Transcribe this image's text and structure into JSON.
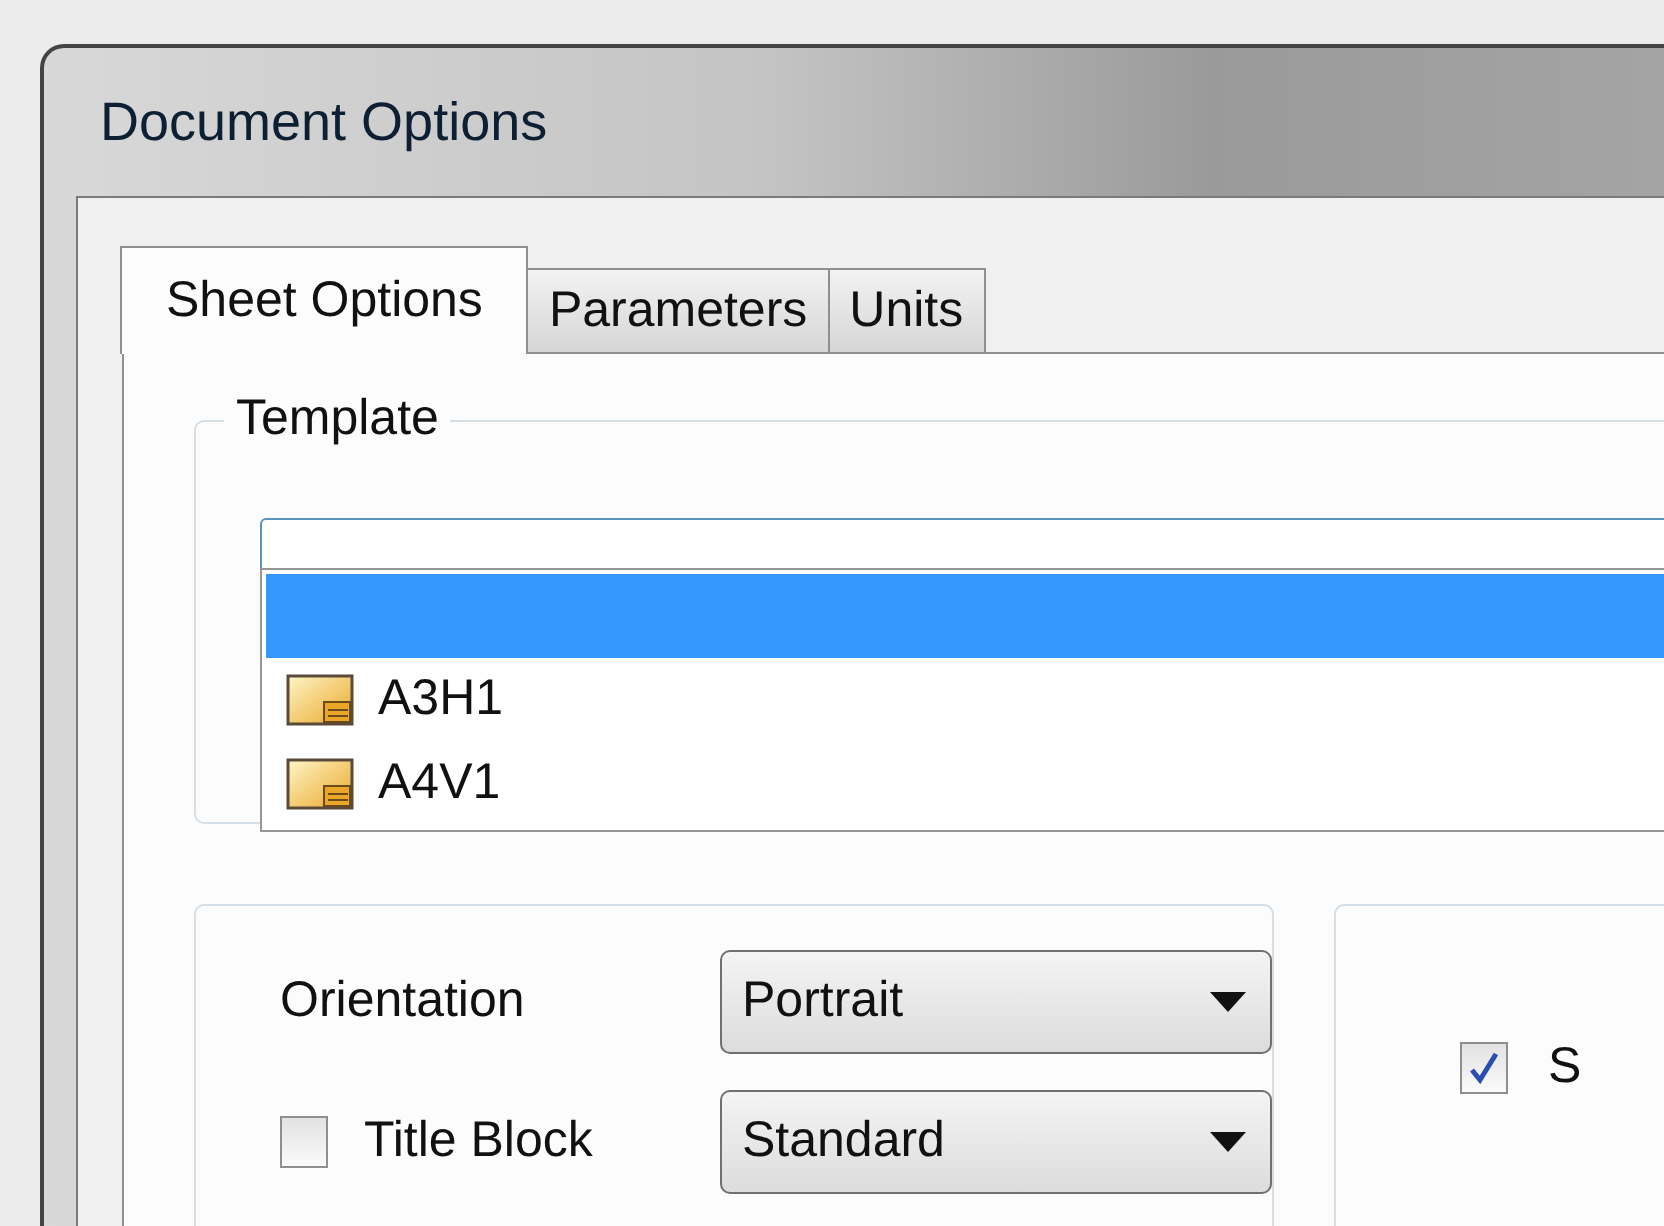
{
  "window": {
    "title": "Document Options"
  },
  "tabs": [
    {
      "label": "Sheet Options",
      "selected": true
    },
    {
      "label": "Parameters",
      "selected": false
    },
    {
      "label": "Units",
      "selected": false
    }
  ],
  "template": {
    "legend": "Template",
    "dropdown": [
      {
        "selected": true
      },
      {
        "label": "A3H1",
        "selected": false
      },
      {
        "label": "A4V1",
        "selected": false
      }
    ]
  },
  "options": {
    "orientation": {
      "label": "Orientation",
      "value": "Portrait"
    },
    "title_block": {
      "label": "Title Block",
      "checked": false,
      "value": "Standard"
    }
  },
  "right_group": {
    "checkbox": {
      "label": "S",
      "checked": true
    }
  }
}
